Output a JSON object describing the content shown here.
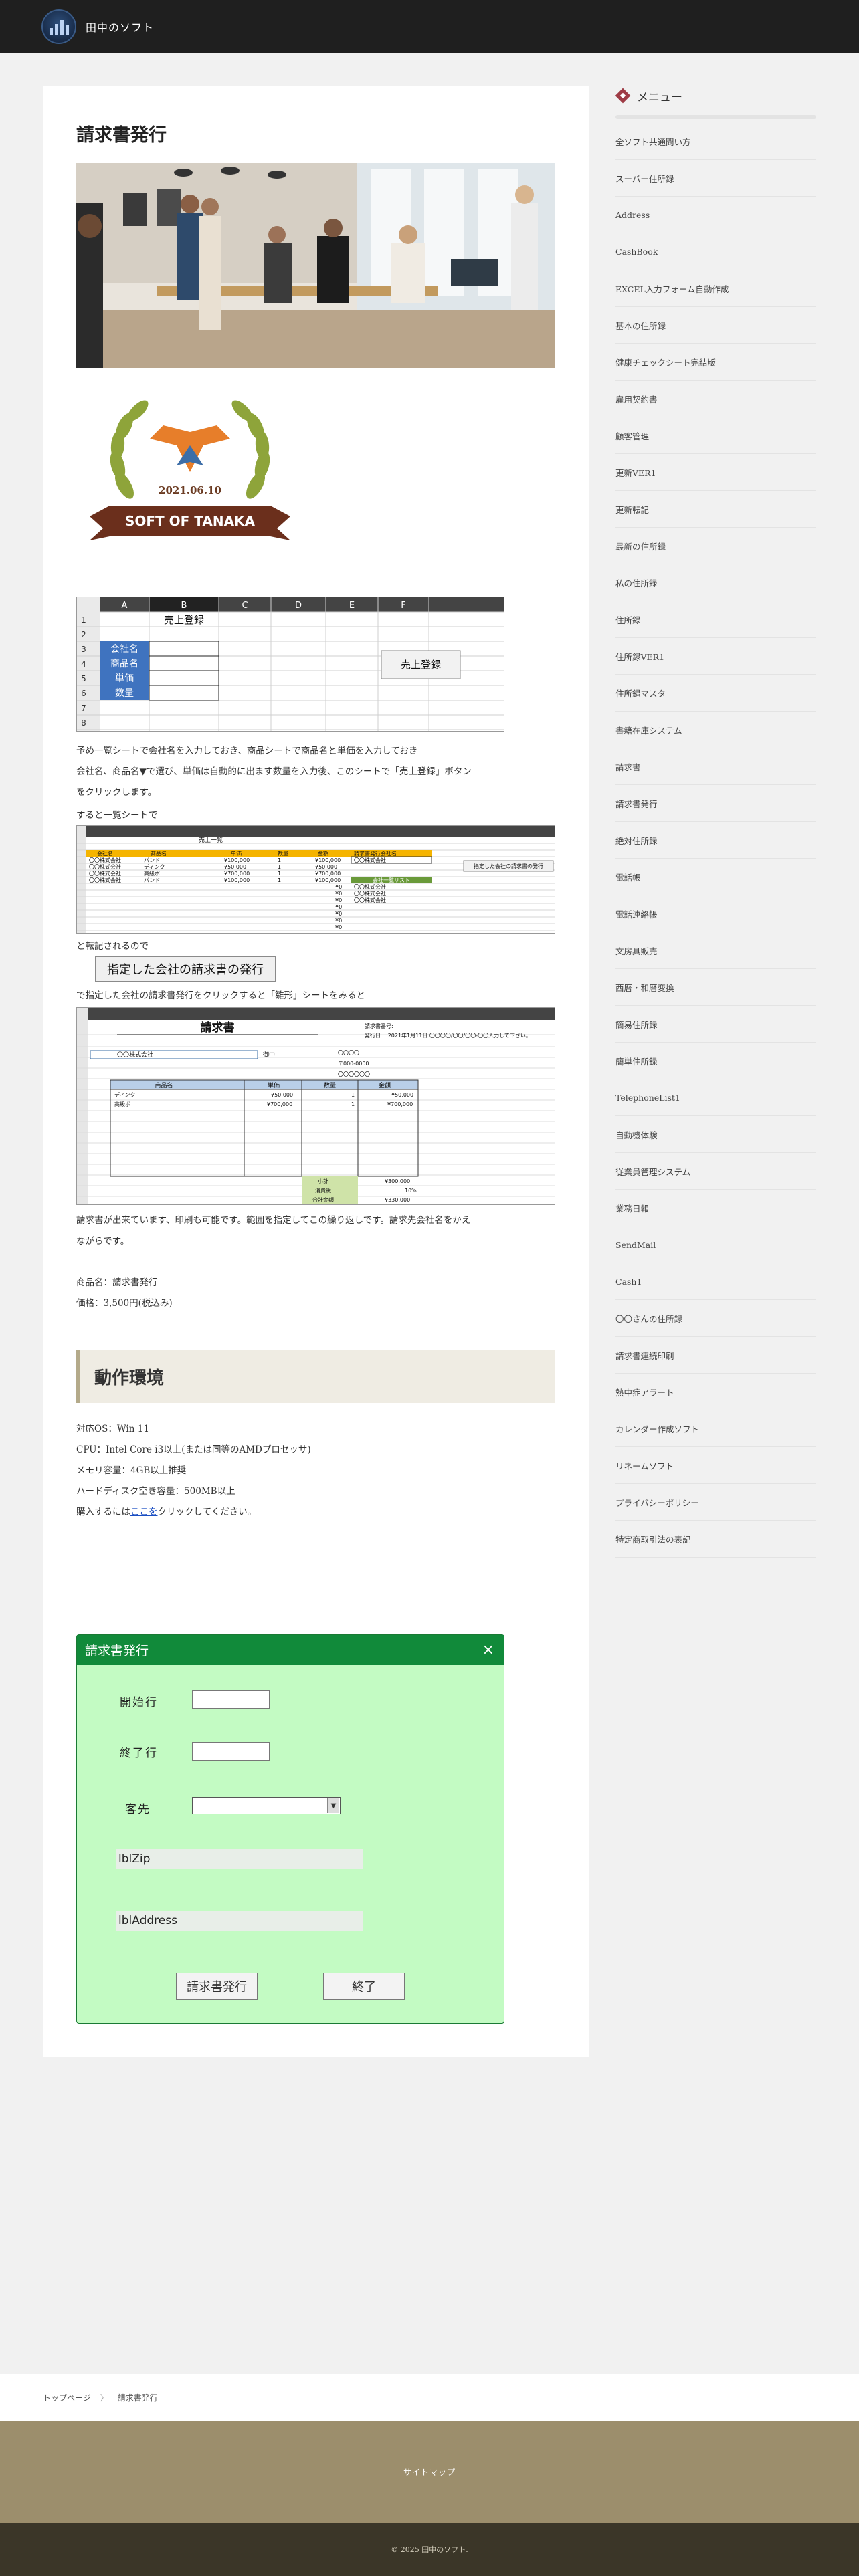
{
  "site": {
    "title": "田中のソフト"
  },
  "article": {
    "title": "請求書発行",
    "badge": {
      "date": "2021.06.10",
      "ribbon": "SOFT OF TANAKA"
    },
    "sheet1": {
      "cols": [
        "A",
        "B",
        "C",
        "D",
        "E",
        "F"
      ],
      "rows": [
        "1",
        "2",
        "3",
        "4",
        "5",
        "6",
        "7",
        "8"
      ],
      "heading": "売上登録",
      "fields": [
        "会社名",
        "商品名",
        "単価",
        "数量"
      ],
      "button": "売上登録"
    },
    "para1_line1": "予め一覧シートで会社名を入力しておき、商品シートで商品名と単価を入力しておき",
    "para1_line2": "会社名、商品名▼で選び、単価は自動的に出ます数量を入力後、このシートで「売上登録」ボタン",
    "para1_line3": "をクリックします。",
    "para1_line4": "すると一覧シートで",
    "sheet2": {
      "heading": "売上一覧",
      "headers": [
        "会社名",
        "商品名",
        "単価",
        "数量",
        "金額"
      ],
      "rows": [
        [
          "〇〇株式会社",
          "パンド",
          "¥100,000",
          "1",
          "¥100,000"
        ],
        [
          "〇〇株式会社",
          "ディンク",
          "¥50,000",
          "1",
          "¥50,000"
        ],
        [
          "〇〇株式会社",
          "高級ボ",
          "¥700,000",
          "1",
          "¥700,000"
        ],
        [
          "〇〇株式会社",
          "パンド",
          "¥100,000",
          "1",
          "¥100,000"
        ]
      ],
      "zero": "¥0",
      "side_title": "請求書発行会社名",
      "side_company": "〇〇株式会社",
      "side_button": "指定した会社の請求書の発行",
      "list_title": "会社一覧リスト",
      "list": [
        "〇〇株式会社",
        "〇〇株式会社",
        "〇〇株式会社"
      ]
    },
    "para2": "と転記されるので",
    "excel_button": "指定した会社の請求書の発行",
    "para3": "で指定した会社の請求書発行をクリックすると「雛形」シートをみると",
    "sheet3": {
      "title": "請求書",
      "invoice_no": "請求書番号:",
      "issue_date": "発行日:　2021年1月11日 〇〇〇〇/〇〇/〇〇-〇〇人力して下さい。",
      "customer": "〇〇株式会社",
      "honorific": "御中",
      "addr1": "〇〇〇〇",
      "addr2": "〒000-0000",
      "addr3": "〇〇〇〇〇〇",
      "item_headers": [
        "商品名",
        "単価",
        "数量",
        "金額"
      ],
      "items": [
        [
          "ディンク",
          "¥50,000",
          "1",
          "¥50,000"
        ],
        [
          "高級ボ",
          "¥700,000",
          "1",
          "¥700,000"
        ]
      ],
      "subtotal_label": "小計",
      "subtotal": "¥300,000",
      "tax_label": "消費税",
      "tax": "10%",
      "total_label": "合計金額",
      "total": "¥330,000"
    },
    "para4_line1": "請求書が出来ています、印刷も可能です。範囲を指定してこの繰り返しです。請求先会社名をかえ",
    "para4_line2": "ながらです。",
    "product_name": "商品名：請求書発行",
    "price": "価格：3,500円(税込み)",
    "env_heading": "動作環境",
    "env_os": "対応OS：Win 11",
    "env_cpu": "CPU：Intel Core i3以上(または同等のAMDプロセッサ)",
    "env_mem": "メモリ容量：4GB以上推奨",
    "env_disk": "ハードディスク空き容量：500MB以上",
    "env_buy_pre": "購入するには",
    "env_buy_link": "ここを",
    "env_buy_post": "クリックしてください。"
  },
  "dialog": {
    "title": "請求書発行",
    "close": "×",
    "start_label": "開始行",
    "end_label": "終了行",
    "customer_label": "客先",
    "zip_label": "lblZip",
    "address_label": "lblAddress",
    "issue_button": "請求書発行",
    "exit_button": "終了",
    "select_arrow": "▼"
  },
  "sidebar": {
    "heading": "メニュー",
    "items": [
      "全ソフト共通問い方",
      "スーパー住所録",
      "Address",
      "CashBook",
      "EXCEL入力フォーム自動作成",
      "基本の住所録",
      "健康チェックシート完結版",
      "雇用契約書",
      "顧客管理",
      "更新VER1",
      "更新転記",
      "最新の住所録",
      "私の住所録",
      "住所録",
      "住所録VER1",
      "住所録マスタ",
      "書籍在庫システム",
      "請求書",
      "請求書発行",
      "絶対住所録",
      "電話帳",
      "電話連絡帳",
      "文房具販売",
      "西暦・和暦変換",
      "簡易住所録",
      "簡単住所録",
      "TelephoneList1",
      "自動機体験",
      "従業員管理システム",
      "業務日報",
      "SendMail",
      "Cash1",
      "〇〇さんの住所録",
      "請求書連続印刷",
      "熱中症アラート",
      "カレンダー作成ソフト",
      "リネームソフト",
      "プライバシーポリシー",
      "特定商取引法の表記"
    ]
  },
  "breadcrumb": {
    "home": "トップページ",
    "sep": "〉",
    "current": "請求書発行"
  },
  "footer": {
    "sitemap": "サイトマップ",
    "copyright": "© 2025 田中のソフト."
  },
  "colors": {
    "header": "#1f1f1f",
    "dialog_bg": "#c3fbc3",
    "dialog_title": "#118a3a",
    "footer": "#9c8e6c",
    "footer_dark": "#3b3628"
  }
}
